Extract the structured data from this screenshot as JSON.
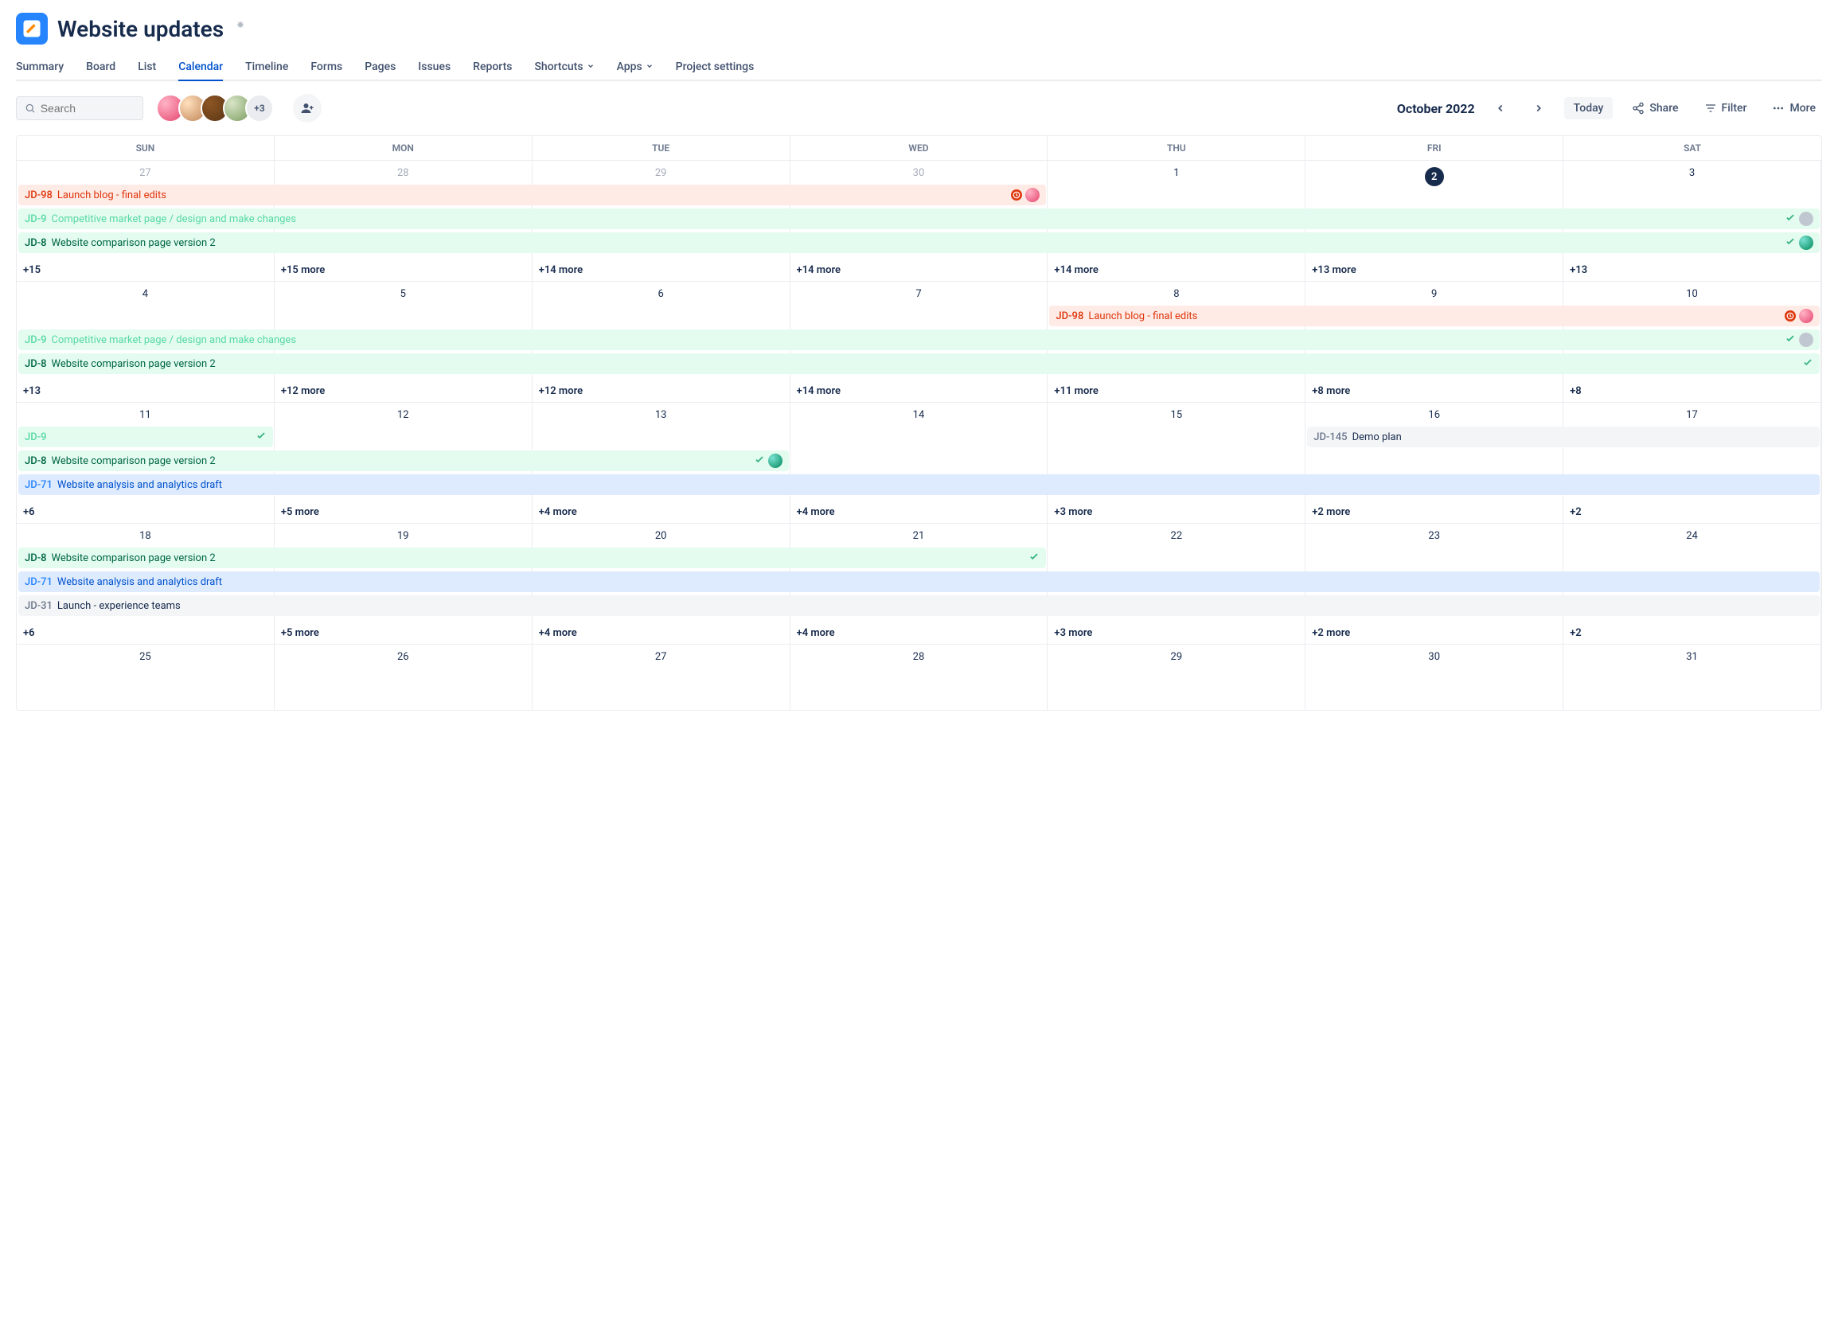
{
  "header": {
    "title": "Website updates"
  },
  "tabs": [
    {
      "label": "Summary"
    },
    {
      "label": "Board"
    },
    {
      "label": "List"
    },
    {
      "label": "Calendar",
      "active": true
    },
    {
      "label": "Timeline"
    },
    {
      "label": "Forms"
    },
    {
      "label": "Pages"
    },
    {
      "label": "Issues"
    },
    {
      "label": "Reports"
    },
    {
      "label": "Shortcuts",
      "dropdown": true
    },
    {
      "label": "Apps",
      "dropdown": true
    },
    {
      "label": "Project settings"
    }
  ],
  "toolbar": {
    "search_placeholder": "Search",
    "avatar_overflow": "+3",
    "month_label": "October 2022",
    "today_label": "Today",
    "share_label": "Share",
    "filter_label": "Filter",
    "more_label": "More"
  },
  "weekdays": [
    "SUN",
    "MON",
    "TUE",
    "WED",
    "THU",
    "FRI",
    "SAT"
  ],
  "weeks": [
    {
      "days": [
        {
          "num": "27",
          "outside": true
        },
        {
          "num": "28",
          "outside": true
        },
        {
          "num": "29",
          "outside": true
        },
        {
          "num": "30",
          "outside": true
        },
        {
          "num": "1"
        },
        {
          "num": "2",
          "today": true
        },
        {
          "num": "3"
        }
      ],
      "events": [
        {
          "span": [
            0,
            4
          ],
          "cls": "ev-red",
          "key": "JD-98",
          "title": "Launch blog - final edits",
          "clock": true,
          "avatar": "av1"
        },
        {
          "span": [
            0,
            7
          ],
          "cls": "ev-green-light",
          "key": "JD-9",
          "title": "Competitive market page / design and make changes",
          "check": true,
          "avatar": "av-gray"
        },
        {
          "span": [
            0,
            7
          ],
          "cls": "ev-green",
          "key": "JD-8",
          "title": "Website comparison page version 2",
          "check": true,
          "avatar": "av-teal"
        }
      ],
      "more": [
        "+15",
        "+15 more",
        "+14 more",
        "+14 more",
        "+14 more",
        "+13 more",
        "+13"
      ]
    },
    {
      "days": [
        {
          "num": "4"
        },
        {
          "num": "5"
        },
        {
          "num": "6"
        },
        {
          "num": "7"
        },
        {
          "num": "8"
        },
        {
          "num": "9"
        },
        {
          "num": "10"
        }
      ],
      "events": [
        {
          "span": [
            4,
            7
          ],
          "cls": "ev-red",
          "key": "JD-98",
          "title": "Launch blog - final edits",
          "clock": true,
          "avatar": "av1",
          "row": 0
        },
        {
          "span": [
            0,
            7
          ],
          "cls": "ev-green-light",
          "key": "JD-9",
          "title": "Competitive market page / design and make changes",
          "check": true,
          "avatar": "av-gray",
          "row": 1
        },
        {
          "span": [
            0,
            7
          ],
          "cls": "ev-green",
          "key": "JD-8",
          "title": "Website comparison page version 2",
          "check": true,
          "row": 2
        }
      ],
      "more": [
        "+13",
        "+12 more",
        "+12 more",
        "+14 more",
        "+11 more",
        "+8 more",
        "+8"
      ]
    },
    {
      "days": [
        {
          "num": "11"
        },
        {
          "num": "12"
        },
        {
          "num": "13"
        },
        {
          "num": "14"
        },
        {
          "num": "15"
        },
        {
          "num": "16"
        },
        {
          "num": "17"
        }
      ],
      "events": [
        {
          "span": [
            0,
            1
          ],
          "cls": "ev-green-light",
          "key": "JD-9",
          "title": "",
          "check": true,
          "row": 0
        },
        {
          "span": [
            5,
            7
          ],
          "cls": "ev-gray",
          "key": "JD-145",
          "title": "Demo plan",
          "row": 0
        },
        {
          "span": [
            0,
            3
          ],
          "cls": "ev-green",
          "key": "JD-8",
          "title": "Website comparison page version 2",
          "check": true,
          "avatar": "av-teal",
          "row": 1
        },
        {
          "span": [
            0,
            7
          ],
          "cls": "ev-blue",
          "key": "JD-71",
          "title": "Website analysis and analytics draft",
          "row": 2
        }
      ],
      "more": [
        "+6",
        "+5 more",
        "+4 more",
        "+4 more",
        "+3 more",
        "+2 more",
        "+2"
      ]
    },
    {
      "days": [
        {
          "num": "18"
        },
        {
          "num": "19"
        },
        {
          "num": "20"
        },
        {
          "num": "21"
        },
        {
          "num": "22"
        },
        {
          "num": "23"
        },
        {
          "num": "24"
        }
      ],
      "events": [
        {
          "span": [
            0,
            4
          ],
          "cls": "ev-green",
          "key": "JD-8",
          "title": "Website comparison page version 2",
          "check": true,
          "row": 0
        },
        {
          "span": [
            0,
            7
          ],
          "cls": "ev-blue",
          "key": "JD-71",
          "title": "Website analysis and analytics draft",
          "row": 1
        },
        {
          "span": [
            0,
            7
          ],
          "cls": "ev-gray",
          "key": "JD-31",
          "title": "Launch - experience teams",
          "row": 2
        }
      ],
      "more": [
        "+6",
        "+5 more",
        "+4 more",
        "+4 more",
        "+3 more",
        "+2 more",
        "+2"
      ]
    },
    {
      "days": [
        {
          "num": "25"
        },
        {
          "num": "26"
        },
        {
          "num": "27"
        },
        {
          "num": "28"
        },
        {
          "num": "29"
        },
        {
          "num": "30"
        },
        {
          "num": "31"
        }
      ],
      "events": [],
      "more": [
        "",
        "",
        "",
        "",
        "",
        "",
        ""
      ]
    }
  ]
}
